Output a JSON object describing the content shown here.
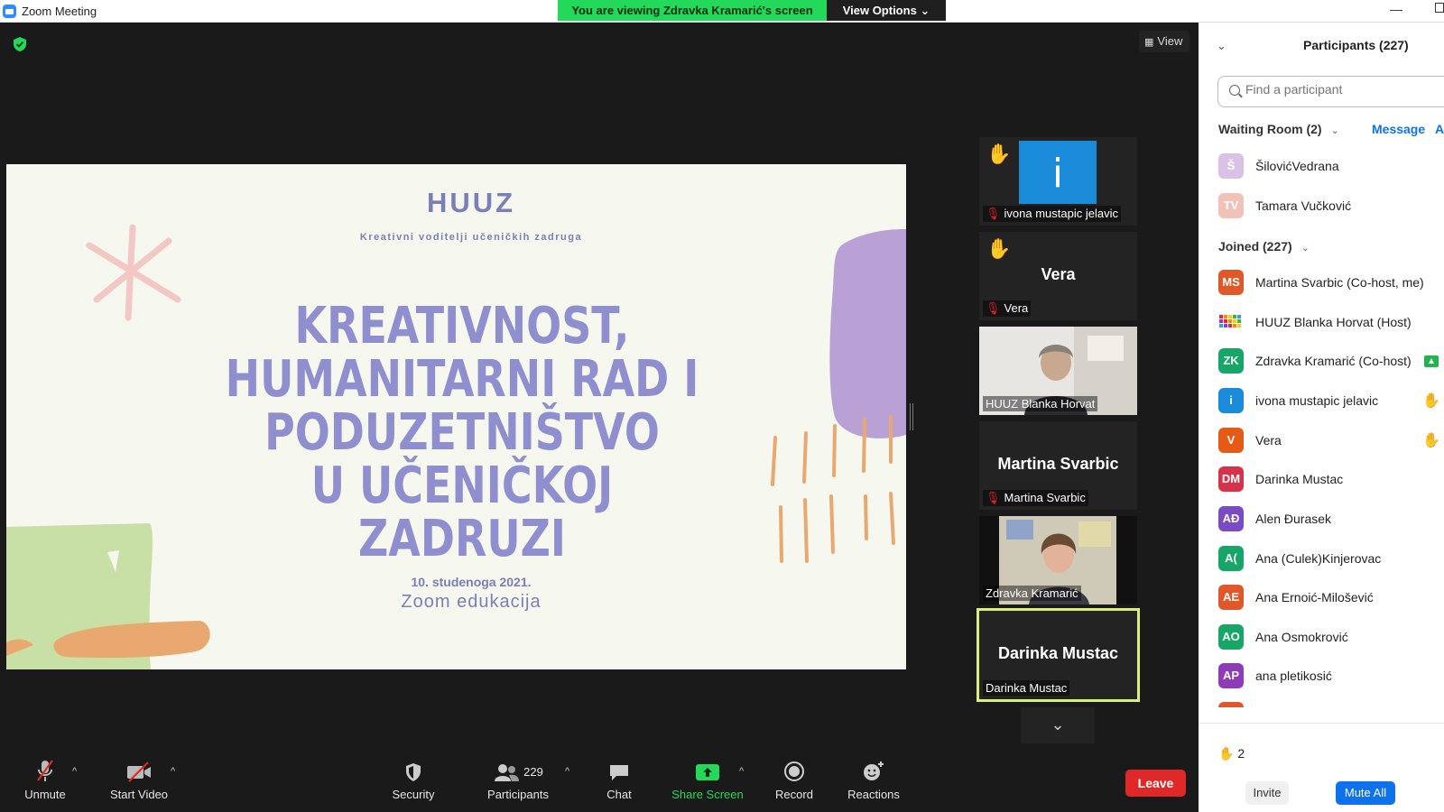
{
  "window": {
    "title": "Zoom Meeting"
  },
  "banner": {
    "text": "You are viewing Zdravka Kramarić's screen",
    "view_options": "View Options ⌄"
  },
  "view_button": "View",
  "slide": {
    "brand": "HUUZ",
    "subtitle": "Kreativni voditelji učeničkih zadruga",
    "title_lines": [
      "KREATIVNOST,",
      "HUMANITARNI RAD I",
      "PODUZETNIŠTVO",
      "U UČENIČKOJ ZADRUZI"
    ],
    "date": "10. studenoga 2021.",
    "event": "Zoom edukacija"
  },
  "tiles": [
    {
      "name": "ivona mustapic jelavic",
      "label": "ivona mustapic jelavic",
      "hand": true,
      "muted": true,
      "type": "icon",
      "icon_letter": "i"
    },
    {
      "name": "Vera",
      "label": "Vera",
      "hand": true,
      "muted": true,
      "type": "name"
    },
    {
      "name": "HUUZ Blanka Horvat",
      "label": "HUUZ Blanka Horvat",
      "type": "video"
    },
    {
      "name": "Martina Svarbic",
      "label": "Martina Svarbic",
      "muted": true,
      "type": "name"
    },
    {
      "name": "Zdravka Kramarić",
      "label": "Zdravka Kramarić",
      "type": "video"
    },
    {
      "name": "Darinka Mustac",
      "label": "Darinka Mustac",
      "type": "name",
      "active": true
    }
  ],
  "toolbar": {
    "unmute": "Unmute",
    "start_video": "Start Video",
    "security": "Security",
    "participants": "Participants",
    "participants_count": "229",
    "chat": "Chat",
    "share_screen": "Share Screen",
    "record": "Record",
    "reactions": "Reactions",
    "leave": "Leave"
  },
  "panel": {
    "title": "Participants (227)",
    "search_placeholder": "Find a participant",
    "waiting_room": "Waiting Room (2)",
    "message": "Message",
    "admit": "A",
    "waiting": [
      {
        "initials": "Š",
        "name": "ŠilovićVedrana",
        "color": "#d9c2e6"
      },
      {
        "initials": "TV",
        "name": "Tamara Vučković",
        "color": "#f0c2b8"
      }
    ],
    "joined_label": "Joined (227)",
    "joined": [
      {
        "initials": "MS",
        "name": "Martina Svarbic (Co-host, me)",
        "color": "#e0582a"
      },
      {
        "initials": "",
        "name": "HUUZ Blanka Horvat (Host)",
        "color": "#ffffff",
        "logo": true
      },
      {
        "initials": "ZK",
        "name": "Zdravka Kramarić (Co-host)",
        "color": "#17a667",
        "sharing": true
      },
      {
        "initials": "i",
        "name": "ivona mustapic jelavic",
        "color": "#1a8bd8",
        "hand": true
      },
      {
        "initials": "V",
        "name": "Vera",
        "color": "#e55a14",
        "hand": true
      },
      {
        "initials": "DM",
        "name": "Darinka Mustac",
        "color": "#d6334a"
      },
      {
        "initials": "AĐ",
        "name": "Alen Đurasek",
        "color": "#7a4bc4"
      },
      {
        "initials": "A(",
        "name": "Ana (Culek)Kinjerovac",
        "color": "#17a667"
      },
      {
        "initials": "AE",
        "name": "Ana Ernoić-Milošević",
        "color": "#e0582a"
      },
      {
        "initials": "AO",
        "name": "Ana Osmokrović",
        "color": "#17a667"
      },
      {
        "initials": "AP",
        "name": "ana pletikosić",
        "color": "#8e3bb8"
      }
    ],
    "raised_hands": "2",
    "invite": "Invite",
    "mute_all": "Mute All"
  },
  "colors": {
    "accent": "#0e72ed",
    "share_green": "#23d959",
    "leave_red": "#e02828",
    "hand_yellow": "#f5b700"
  }
}
